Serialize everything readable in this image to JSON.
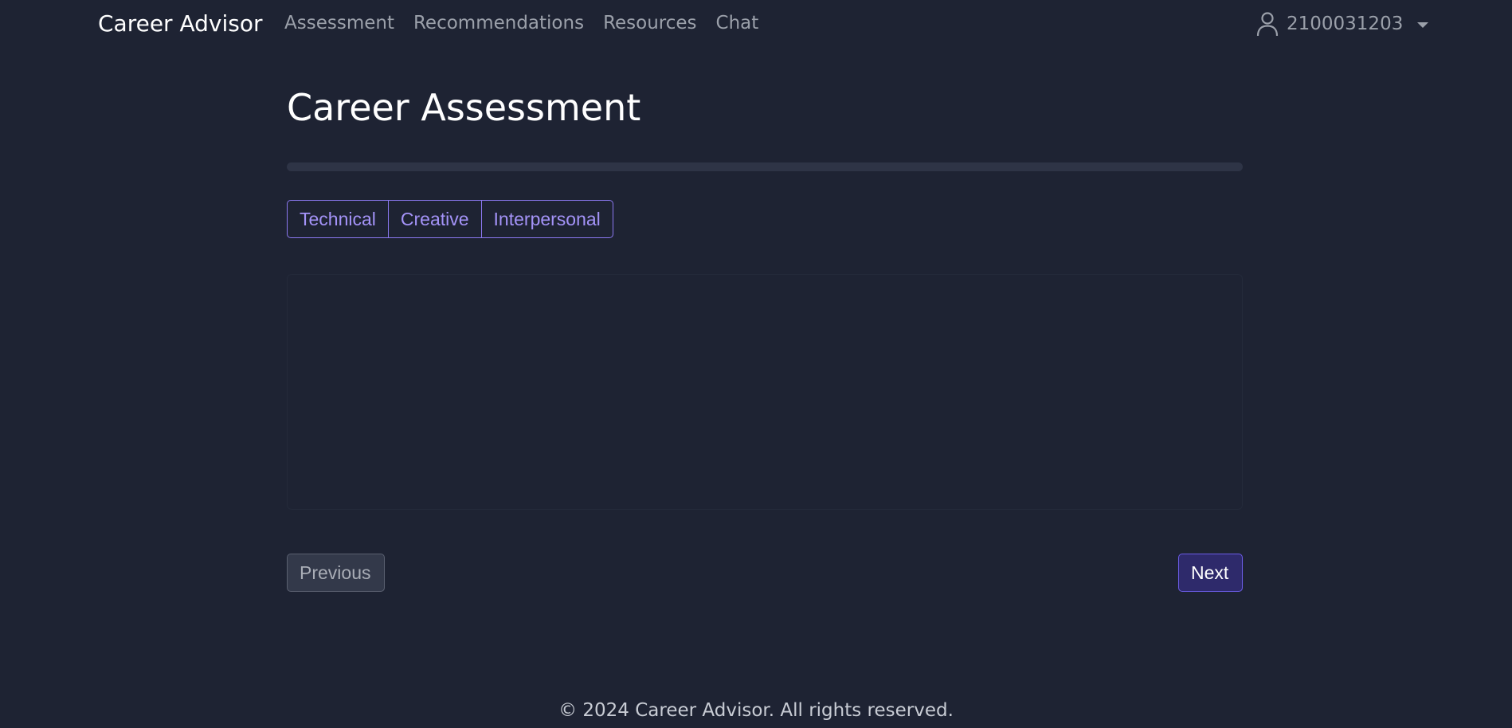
{
  "navbar": {
    "brand": "Career Advisor",
    "links": [
      "Assessment",
      "Recommendations",
      "Resources",
      "Chat"
    ],
    "user": {
      "icon": "user-icon",
      "name": "2100031203"
    }
  },
  "main": {
    "title": "Career Assessment",
    "progress_percent": 0,
    "tabs": [
      {
        "label": "Technical"
      },
      {
        "label": "Creative"
      },
      {
        "label": "Interpersonal"
      }
    ],
    "previous_label": "Previous",
    "next_label": "Next"
  },
  "footer": {
    "text": "© 2024 Career Advisor. All rights reserved."
  },
  "colors": {
    "background": "#1e2333",
    "accent": "#8b78f0",
    "next_button": "#2e2a6b",
    "progress_track": "#2e3446"
  }
}
